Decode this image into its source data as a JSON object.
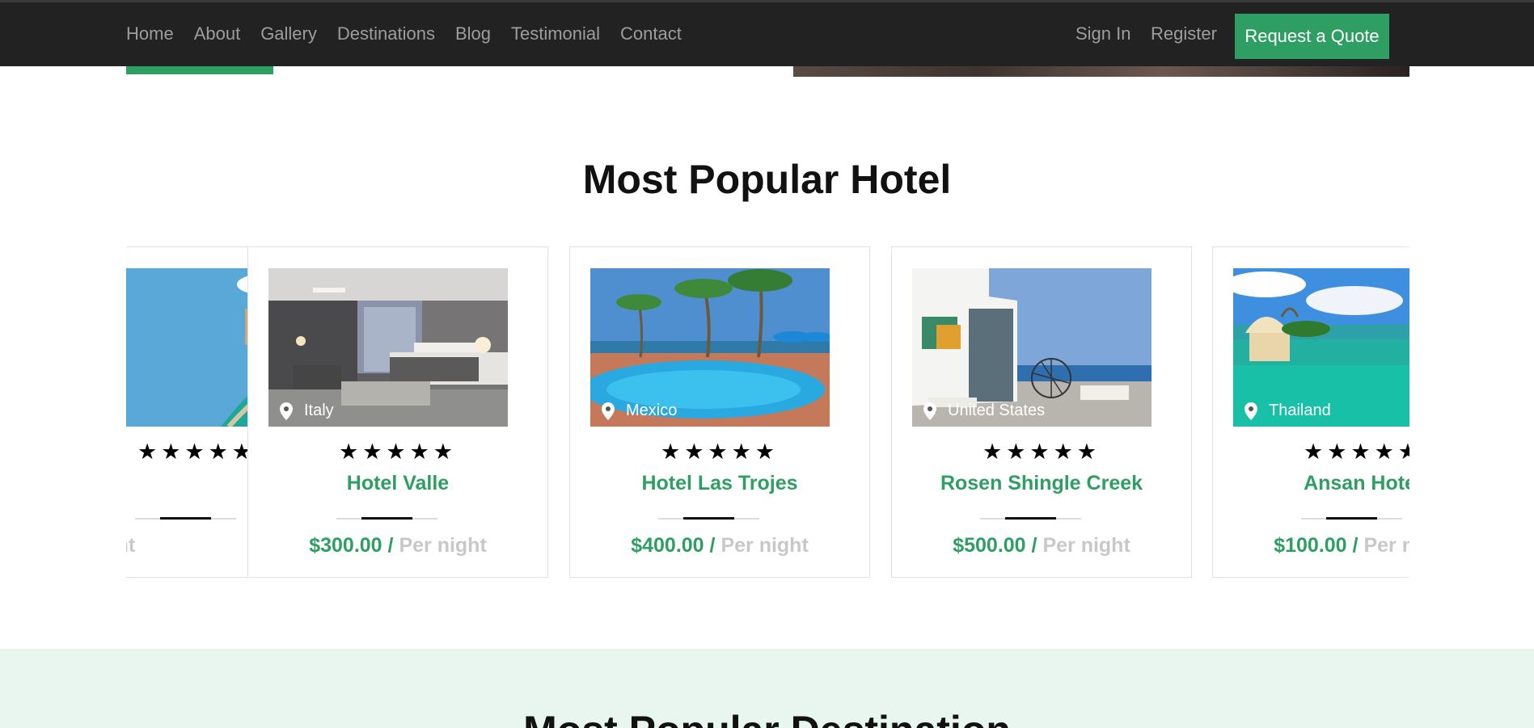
{
  "navbar": {
    "links": [
      "Home",
      "About",
      "Gallery",
      "Destinations",
      "Blog",
      "Testimonial",
      "Contact"
    ],
    "sign_in": "Sign In",
    "register": "Register",
    "quote_button": "Request a Quote"
  },
  "hotels_section": {
    "title": "Most Popular Hotel",
    "hotels": [
      {
        "location": "",
        "rating": 5,
        "name": "",
        "price": "",
        "per": "Per night"
      },
      {
        "location": "Italy",
        "rating": 5,
        "name": "Hotel Valle",
        "price": "$300.00 /",
        "per": "Per night"
      },
      {
        "location": "Mexico",
        "rating": 5,
        "name": "Hotel Las Trojes",
        "price": "$400.00 /",
        "per": "Per night"
      },
      {
        "location": "United States",
        "rating": 5,
        "name": "Rosen Shingle Creek",
        "price": "$500.00 /",
        "per": "Per night"
      },
      {
        "location": "Thailand",
        "rating": 5,
        "name": "Ansan Hotel",
        "price": "$100.00 /",
        "per": "Per night"
      }
    ]
  },
  "destinations_section": {
    "title": "Most Popular Destination"
  },
  "colors": {
    "accent": "#2e9e62",
    "navbar_bg": "#222222",
    "muted": "#c8c8c8",
    "band_bg": "#e9f5ef"
  },
  "icons": [
    "map-pin-icon",
    "star-icon"
  ]
}
